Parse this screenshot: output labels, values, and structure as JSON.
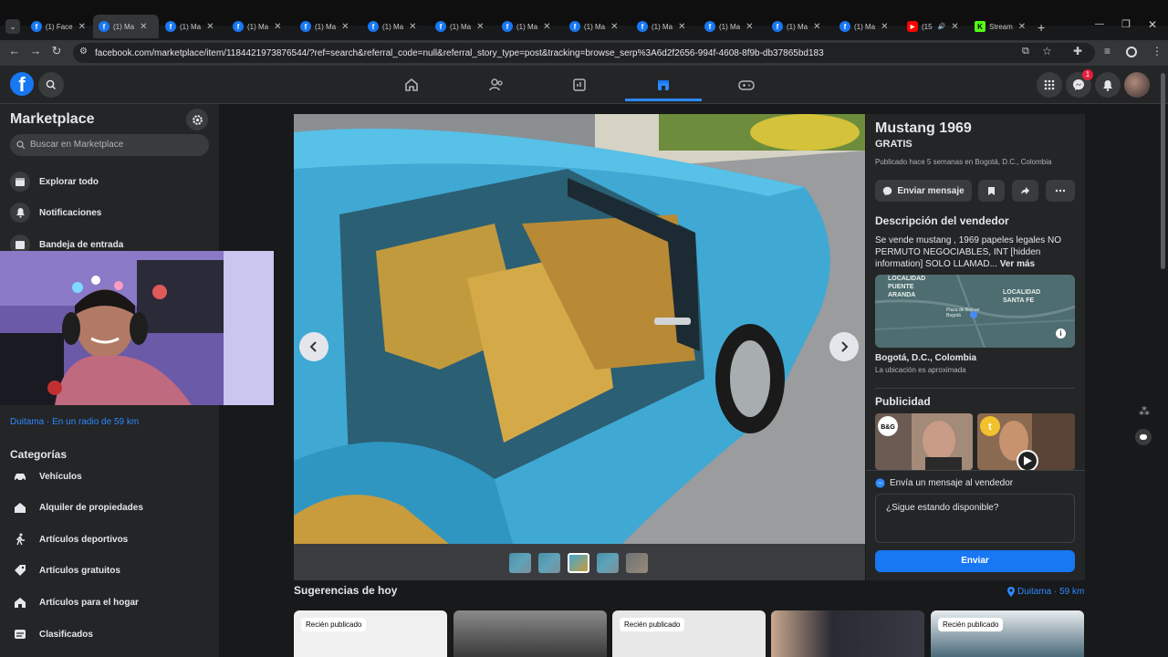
{
  "browser": {
    "tabs": [
      {
        "label": "(1) Face"
      },
      {
        "label": "(1) Ma"
      },
      {
        "label": "(1) Ma"
      },
      {
        "label": "(1) Ma"
      },
      {
        "label": "(1) Ma"
      },
      {
        "label": "(1) Ma"
      },
      {
        "label": "(1) Ma"
      },
      {
        "label": "(1) Ma"
      },
      {
        "label": "(1) Ma"
      },
      {
        "label": "(1) Ma"
      },
      {
        "label": "(1) Ma"
      },
      {
        "label": "(1) Ma"
      },
      {
        "label": "(1) Ma"
      },
      {
        "label": "(15"
      },
      {
        "label": "Stream"
      }
    ],
    "url": "facebook.com/marketplace/item/1184421973876544/?ref=search&referral_code=null&referral_story_type=post&tracking=browse_serp%3A6d2f2656-994f-4608-8f9b-db37865bd183"
  },
  "fb": {
    "messenger_badge": "1"
  },
  "sidebar": {
    "title": "Marketplace",
    "search_placeholder": "Buscar en Marketplace",
    "items": [
      {
        "label": "Explorar todo"
      },
      {
        "label": "Notificaciones"
      },
      {
        "label": "Bandeja de entrada"
      }
    ],
    "location": "Duitama · En un radio de 59 km",
    "categories_title": "Categorías",
    "categories": [
      {
        "label": "Vehículos"
      },
      {
        "label": "Alquiler de propiedades"
      },
      {
        "label": "Artículos deportivos"
      },
      {
        "label": "Artículos gratuitos"
      },
      {
        "label": "Artículos para el hogar"
      },
      {
        "label": "Clasificados"
      }
    ]
  },
  "listing": {
    "title": "Mustang 1969",
    "price": "GRATIS",
    "published": "Publicado hace 5 semanas en Bogotá, D.C., Colombia",
    "send_message_label": "Enviar mensaje",
    "seller_desc_title": "Descripción del vendedor",
    "description": "Se vende mustang , 1969 papeles legales NO PERMUTO NEGOCIABLES, INT [hidden information] SOLO LLAMAD...",
    "see_more": "Ver más",
    "map_labels": {
      "l1": "LOCALIDAD PUENTE ARANDA",
      "l2": "LOCALIDAD SANTA FE",
      "l3": "Plaza de Bolívar Bogotá"
    },
    "location": "Bogotá, D.C., Colombia",
    "location_note": "La ubicación es aproximada",
    "ads_title": "Publicidad",
    "message_prompt": "Envía un mensaje al vendedor",
    "message_value": "¿Sigue estando disponible?",
    "send_label": "Enviar"
  },
  "suggestions": {
    "title": "Sugerencias de hoy",
    "location": "Duitama · 59 km",
    "badges": [
      "Recién publicado",
      "Recién publicado",
      "Recién publicado"
    ]
  },
  "colors": {
    "fb_blue": "#1877f2",
    "car_blue": "#3fa9d4",
    "background": "#18191a",
    "panel": "#242526"
  }
}
